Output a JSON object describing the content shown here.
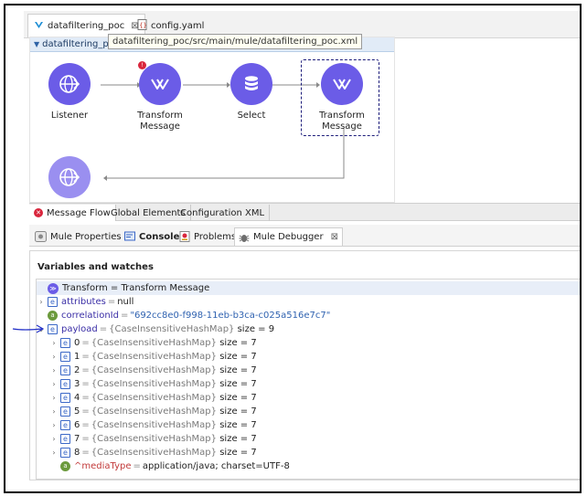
{
  "editor_tabs": [
    {
      "label": "datafiltering_poc",
      "active": true
    },
    {
      "label": "config.yaml",
      "active": false
    }
  ],
  "tooltip": "datafiltering_poc/src/main/mule/datafiltering_poc.xml",
  "flow": {
    "name": "datafiltering_poc",
    "nodes": [
      {
        "label": "Listener",
        "icon": "globe-icon"
      },
      {
        "label": "Transform Message",
        "icon": "transform-icon",
        "error": true
      },
      {
        "label": "Select",
        "icon": "database-icon"
      },
      {
        "label": "Transform Message",
        "icon": "transform-icon",
        "selected": true
      }
    ],
    "response_node": {
      "icon": "globe-icon"
    }
  },
  "canvas_tabs": [
    "Message Flow",
    "Global Elements",
    "Configuration XML"
  ],
  "view_tabs": [
    {
      "label": "Mule Properties",
      "icon": "properties-icon"
    },
    {
      "label": "Console",
      "icon": "console-icon"
    },
    {
      "label": "Problems",
      "icon": "problems-icon"
    },
    {
      "label": "Mule Debugger",
      "icon": "debugger-icon",
      "active": true
    }
  ],
  "debugger": {
    "title": "Variables and watches",
    "transform_row": "Transform = Transform Message",
    "attributes": {
      "name": "attributes",
      "value": "null"
    },
    "correlationId": {
      "name": "correlationId",
      "value": "\"692cc8e0-f998-11eb-b3ca-c025a516e7c7\""
    },
    "payload": {
      "name": "payload",
      "type": "{CaseInsensitiveHashMap}",
      "size": "size = 9"
    },
    "items": [
      {
        "name": "0",
        "type": "{CaseInsensitiveHashMap}",
        "size": "size = 7"
      },
      {
        "name": "1",
        "type": "{CaseInsensitiveHashMap}",
        "size": "size = 7"
      },
      {
        "name": "2",
        "type": "{CaseInsensitiveHashMap}",
        "size": "size = 7"
      },
      {
        "name": "3",
        "type": "{CaseInsensitiveHashMap}",
        "size": "size = 7"
      },
      {
        "name": "4",
        "type": "{CaseInsensitiveHashMap}",
        "size": "size = 7"
      },
      {
        "name": "5",
        "type": "{CaseInsensitiveHashMap}",
        "size": "size = 7"
      },
      {
        "name": "6",
        "type": "{CaseInsensitiveHashMap}",
        "size": "size = 7"
      },
      {
        "name": "7",
        "type": "{CaseInsensitiveHashMap}",
        "size": "size = 7"
      },
      {
        "name": "8",
        "type": "{CaseInsensitiveHashMap}",
        "size": "size = 7"
      }
    ],
    "mediaType": {
      "name": "^mediaType",
      "value": "application/java; charset=UTF-8"
    }
  },
  "colors": {
    "node_purple": "#6b5ce7",
    "selection_border": "#1c1c7a",
    "error_red": "#d9263d",
    "annotation_blue": "#2432c8"
  }
}
